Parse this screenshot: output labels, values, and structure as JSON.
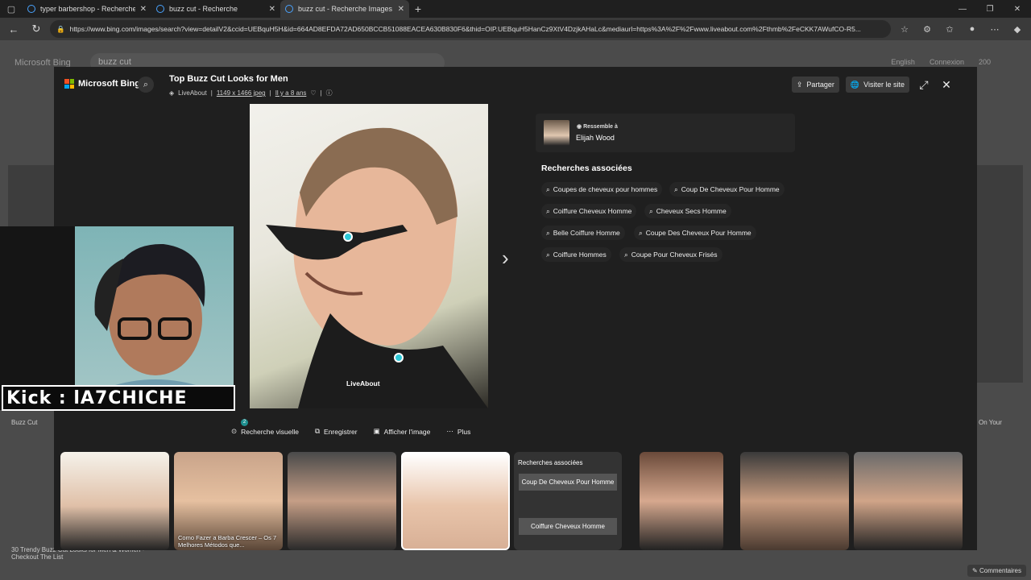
{
  "browser": {
    "tabs": [
      {
        "title": "typer barbershop - Recherche Im..."
      },
      {
        "title": "buzz cut - Recherche"
      },
      {
        "title": "buzz cut - Recherche Images"
      }
    ],
    "url": "https://www.bing.com/images/search?view=detailV2&ccid=UEBquH5H&id=664AD8EFDA72AD650BCCB51088EACEA630B830F6&thid=OIP.UEBquH5HanCz9XtV4DzjkAHaLc&mediaurl=https%3A%2F%2Fwww.liveabout.com%2Fthmb%2FeCKK7AWufCO-R5..."
  },
  "bg": {
    "logo": "Microsoft Bing",
    "query": "buzz cut",
    "lang": "English",
    "signin": "Connexion",
    "count": "200",
    "captions": [
      "Buzz Cut",
      "30 Trendy Buzz Cut Looks for Men & Women - Checkout The List",
      "On Your"
    ]
  },
  "modal": {
    "logo": "Microsoft Bing",
    "title": "Top Buzz Cut Looks for Men",
    "source": "LiveAbout",
    "dims": "1149 x 1466 jpeg",
    "age": "Il y a 8 ans",
    "share": "Partager",
    "visit": "Visiter le site",
    "credit": "LiveAbout",
    "resembles_label": "Ressemble à",
    "resembles_name": "Elijah Wood",
    "related_title": "Recherches associées",
    "related": [
      "Coupes de cheveux pour hommes",
      "Coup De Cheveux Pour Homme",
      "Coiffure Cheveux Homme",
      "Cheveux Secs Homme",
      "Belle Coiffure Homme",
      "Coupe Des Cheveux Pour Homme",
      "Coiffure Hommes",
      "Coupe Pour Cheveux Frisés"
    ],
    "actions": {
      "visual": "Recherche visuelle",
      "visual_badge": "2",
      "save": "Enregistrer",
      "view": "Afficher l'image",
      "more": "Plus"
    },
    "strip": {
      "captions": [
        "Como Fazer a Barba Crescer – Os 7 Melhores Métodos que..."
      ],
      "related_head": "Recherches associées",
      "related_items": [
        "Coup De Cheveux Pour Homme",
        "Coiffure Cheveux Homme"
      ]
    }
  },
  "overlay": {
    "kick": "Kick : lA7CHICHE"
  },
  "footer": {
    "comments": "Commentaires"
  }
}
